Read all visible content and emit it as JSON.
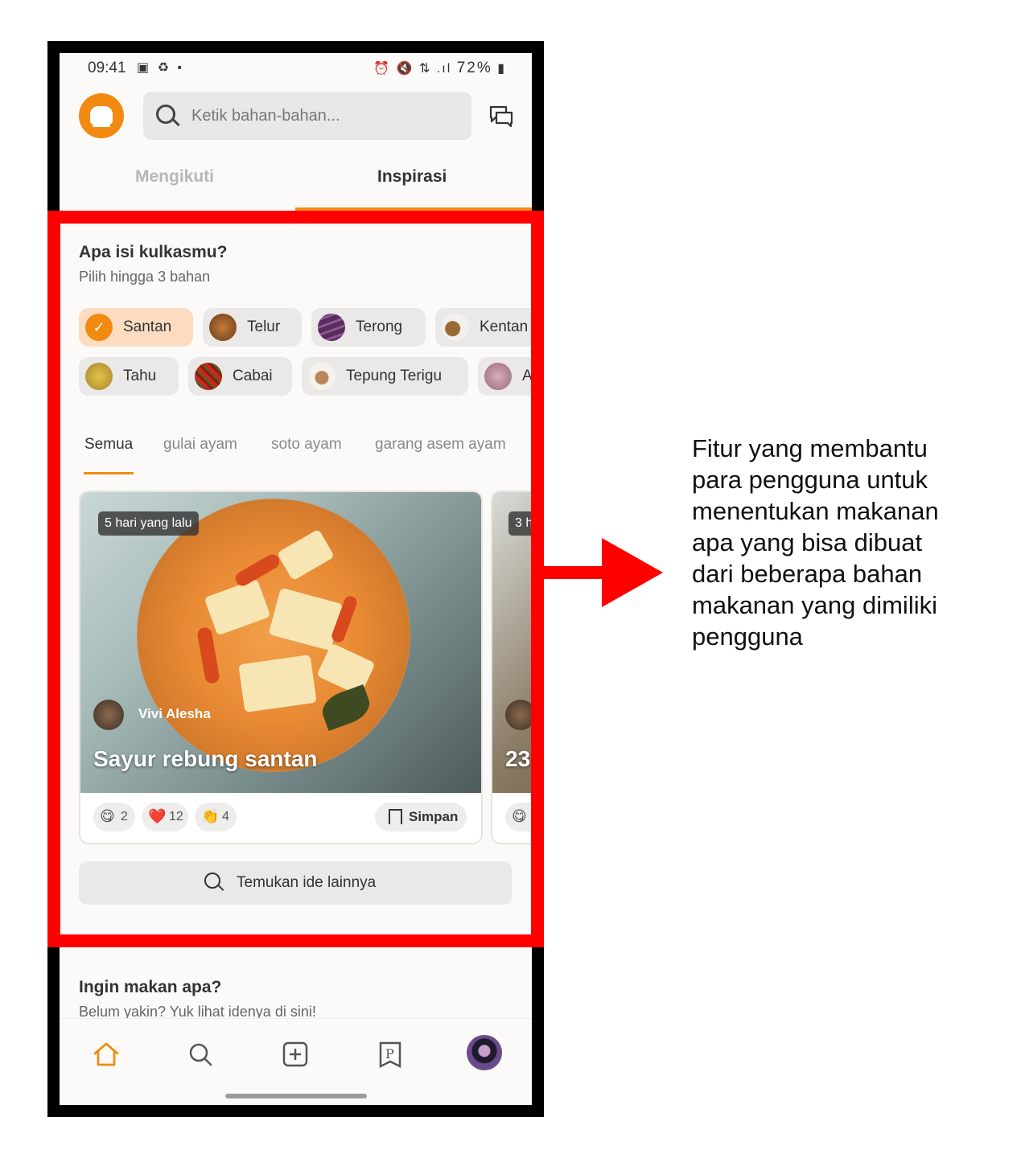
{
  "status_bar": {
    "time": "09:41",
    "battery": "72%"
  },
  "header": {
    "search_placeholder": "Ketik bahan-bahan...",
    "tabs": [
      "Mengikuti",
      "Inspirasi"
    ],
    "active_tab": "Inspirasi"
  },
  "fridge": {
    "title": "Apa isi kulkasmu?",
    "subtitle": "Pilih hingga 3 bahan",
    "chips_row1": [
      "Santan",
      "Telur",
      "Terong",
      "Kentan"
    ],
    "chips_row2": [
      "Tahu",
      "Cabai",
      "Tepung Terigu",
      "A"
    ]
  },
  "categories": [
    "Semua",
    "gulai ayam",
    "soto ayam",
    "garang asem ayam"
  ],
  "recipe_card": {
    "time_ago": "5 hari yang lalu",
    "author": "Vivi Alesha",
    "title": "Sayur rebung santan",
    "reactions": [
      {
        "emoji": "😋",
        "count": "2"
      },
      {
        "emoji": "❤️",
        "count": "12"
      },
      {
        "emoji": "👏",
        "count": "4"
      }
    ],
    "save_label": "Simpan"
  },
  "next_card": {
    "time_ago": "3 h",
    "title": "23"
  },
  "find_more": "Temukan ide lainnya",
  "ingin": {
    "title": "Ingin makan apa?",
    "subtitle": "Belum yakin? Yuk lihat idenya di sini!"
  },
  "annotation": "Fitur yang membantu para pengguna untuk menentukan makanan apa yang bisa dibuat dari beberapa bahan makanan yang dimiliki pengguna",
  "colors": {
    "accent": "#f28a12",
    "highlight": "#ff0000"
  }
}
